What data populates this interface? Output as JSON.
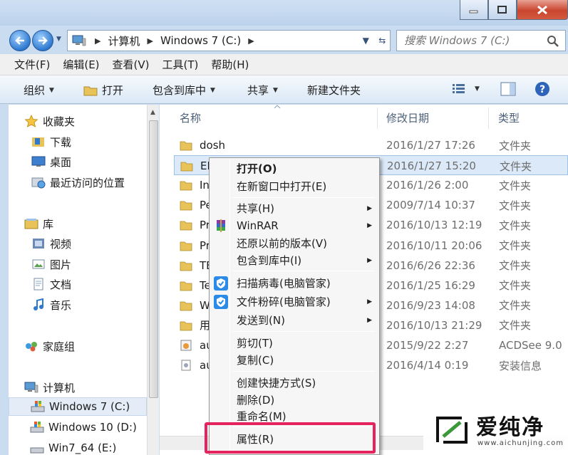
{
  "address": {
    "crumbs": [
      "计算机",
      "Windows 7 (C:)"
    ]
  },
  "search": {
    "placeholder": "搜索 Windows 7 (C:)"
  },
  "menubar": [
    "文件(F)",
    "编辑(E)",
    "查看(V)",
    "工具(T)",
    "帮助(H)"
  ],
  "toolbar": {
    "organize": "组织",
    "open": "打开",
    "include_in_library": "包含到库中",
    "share": "共享",
    "new_folder": "新建文件夹"
  },
  "nav": {
    "favorites": "收藏夹",
    "downloads": "下载",
    "desktop": "桌面",
    "recent": "最近访问的位置",
    "libraries": "库",
    "videos": "视频",
    "pictures": "图片",
    "documents": "文档",
    "music": "音乐",
    "homegroup": "家庭组",
    "computer": "计算机",
    "drive_c": "Windows 7 (C:)",
    "drive_d": "Windows 10 (D:)",
    "drive_e": "Win7_64 (E:)"
  },
  "columns": {
    "name": "名称",
    "modified": "修改日期",
    "type": "类型"
  },
  "files": [
    {
      "name": "dosh",
      "date": "2016/1/27 17:26",
      "type": "文件夹"
    },
    {
      "name": "EF",
      "date": "2016/1/27 15:20",
      "type": "文件夹"
    },
    {
      "name": "In",
      "date": "2016/1/26 2:00",
      "type": "文件夹"
    },
    {
      "name": "Pe",
      "date": "2009/7/14 10:37",
      "type": "文件夹"
    },
    {
      "name": "Pr",
      "date": "2016/10/13 12:19",
      "type": "文件夹"
    },
    {
      "name": "Pr",
      "date": "2016/10/11 20:06",
      "type": "文件夹"
    },
    {
      "name": "TE",
      "date": "2016/6/26 22:36",
      "type": "文件夹"
    },
    {
      "name": "Te",
      "date": "2016/1/25 16:29",
      "type": "文件夹"
    },
    {
      "name": "W",
      "date": "2016/9/23 14:08",
      "type": "文件夹"
    },
    {
      "name": "用",
      "date": "2016/10/13 21:29",
      "type": "文件夹"
    },
    {
      "name": "au",
      "date": "2015/9/22 2:27",
      "type": "ACDSee 9.0"
    },
    {
      "name": "au",
      "date": "2016/4/14 0:19",
      "type": "安装信息"
    }
  ],
  "context_menu": {
    "open": "打开(O)",
    "open_new_window": "在新窗口中打开(E)",
    "share": "共享(H)",
    "winrar": "WinRAR",
    "restore": "还原以前的版本(V)",
    "include_library": "包含到库中(I)",
    "scan_virus": "扫描病毒(电脑管家)",
    "shred": "文件粉碎(电脑管家)",
    "send_to": "发送到(N)",
    "cut": "剪切(T)",
    "copy": "复制(C)",
    "create_shortcut": "创建快捷方式(S)",
    "delete": "删除(D)",
    "rename": "重命名(M)",
    "properties": "属性(R)"
  },
  "watermark": {
    "text": "爱纯净",
    "url": "www.aichunjing.com"
  },
  "colors": {
    "accent": "#2f79cf",
    "highlight": "#e5245f",
    "folder": "#e8c35a"
  }
}
